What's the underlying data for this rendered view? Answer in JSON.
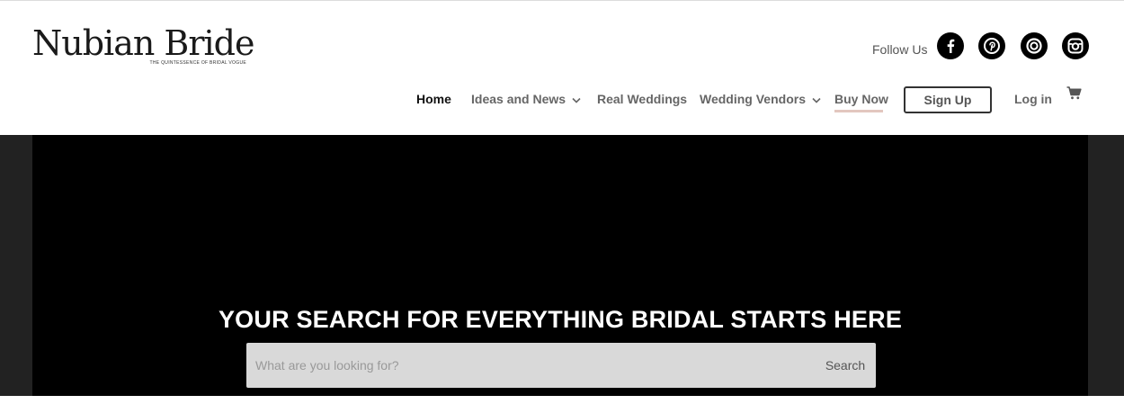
{
  "brand": {
    "name": "Nubian Bride",
    "tagline": "The Quintessence of Bridal Vogue"
  },
  "social": {
    "label": "Follow Us",
    "icons": [
      "facebook-icon",
      "pinterest-icon",
      "issuu-icon",
      "instagram-icon"
    ]
  },
  "nav": {
    "home": "Home",
    "ideas": "Ideas and News",
    "real_weddings": "Real Weddings",
    "vendors": "Wedding Vendors",
    "buy_now": "Buy Now",
    "sign_up": "Sign Up",
    "log_in": "Log in"
  },
  "hero": {
    "title": "YOUR SEARCH FOR EVERYTHING BRIDAL STARTS HERE",
    "search_placeholder": "What are you looking for?",
    "search_button": "Search"
  },
  "colors": {
    "hero_background": "#000000",
    "side_background": "#222222",
    "buy_now_underline": "#e3c7bf",
    "search_box": "#d9d9d9"
  }
}
